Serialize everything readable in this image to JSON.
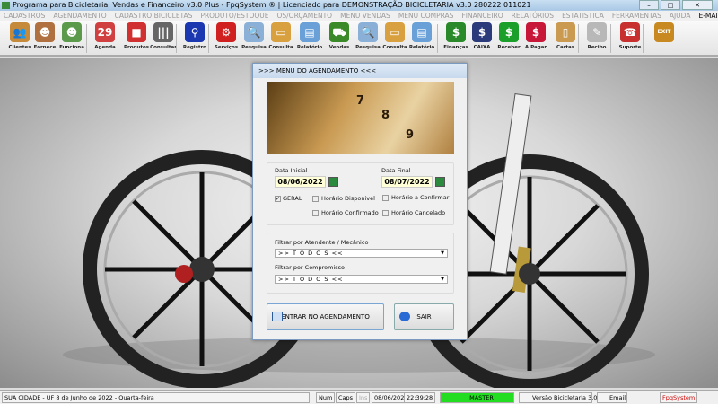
{
  "window": {
    "title": "Programa para Bicicletaria, Vendas e Financeiro v3.0 Plus - FpqSystem ® | Licenciado para  DEMONSTRAÇÃO BICICLETARIA v3.0 280222 011021",
    "minimize": "–",
    "maximize": "□",
    "close": "✕"
  },
  "menu": [
    "CADASTROS",
    "AGENDAMENTO",
    "CADASTRO BICICLETAS",
    "PRODUTO/ESTOQUE",
    "OS/ORÇAMENTO",
    "MENU VENDAS",
    "MENU COMPRAS",
    "FINANCEIRO",
    "RELATÓRIOS",
    "ESTATISTICA",
    "FERRAMENTAS",
    "AJUDA",
    "E-MAIL"
  ],
  "toolbar": [
    {
      "label": "Clientes",
      "color": "#c58a3a",
      "glyph": "👥"
    },
    {
      "label": "Fornece",
      "color": "#b07040",
      "glyph": "☻"
    },
    {
      "label": "Funciona",
      "color": "#5a9a4a",
      "glyph": "☻"
    },
    {
      "label": "Agenda",
      "color": "#d04040",
      "glyph": "29"
    },
    {
      "label": "Produtos",
      "color": "#d03030",
      "glyph": "■"
    },
    {
      "label": "Consultar",
      "color": "#666",
      "glyph": "|||"
    },
    {
      "label": "Registro",
      "color": "#1c38b0",
      "glyph": "⚲"
    },
    {
      "label": "Serviços",
      "color": "#d02020",
      "glyph": "⚙"
    },
    {
      "label": "Pesquisa",
      "color": "#8ab0d8",
      "glyph": "🔍"
    },
    {
      "label": "Consulta",
      "color": "#d9a040",
      "glyph": "▭"
    },
    {
      "label": "Relatório",
      "color": "#6aa0d8",
      "glyph": "▤"
    },
    {
      "label": "Vendas",
      "color": "#3a8a2a",
      "glyph": "⛟"
    },
    {
      "label": "Pesquisa",
      "color": "#8ab0d8",
      "glyph": "🔍"
    },
    {
      "label": "Consulta",
      "color": "#d9a040",
      "glyph": "▭"
    },
    {
      "label": "Relatório",
      "color": "#6aa0d8",
      "glyph": "▤"
    },
    {
      "label": "Finanças",
      "color": "#2a8a2a",
      "glyph": "$"
    },
    {
      "label": "CAIXA",
      "color": "#2a3a7a",
      "glyph": "$"
    },
    {
      "label": "Receber",
      "color": "#1aa02a",
      "glyph": "$"
    },
    {
      "label": "A Pagar",
      "color": "#c8183a",
      "glyph": "$"
    },
    {
      "label": "Cartas",
      "color": "#c99a50",
      "glyph": "▯"
    },
    {
      "label": "Recibo",
      "color": "#b8b8b8",
      "glyph": "✎"
    },
    {
      "label": "Suporte",
      "color": "#c83030",
      "glyph": "☎"
    },
    {
      "label": "",
      "color": "#c88a20",
      "glyph": "EXIT"
    }
  ],
  "dialog": {
    "title": ">>>  MENU DO AGENDAMENTO  <<<",
    "photo_numbers": [
      "7",
      "8",
      "9"
    ],
    "data_inicial_label": "Data Inicial",
    "data_inicial": "08/06/2022",
    "data_final_label": "Data Final",
    "data_final": "08/07/2022",
    "checks": [
      {
        "label": "GERAL",
        "checked": true
      },
      {
        "label": "Horário  Disponivel",
        "checked": false
      },
      {
        "label": "Horário a Confirmar",
        "checked": false
      },
      {
        "label": "Horário Confirmado",
        "checked": false
      },
      {
        "label": "Horário Cancelado",
        "checked": false
      }
    ],
    "filtro_atendente_label": "Filtrar por Atendente / Mecânico",
    "filtro_atendente": ">> T O D O S <<",
    "filtro_compromisso_label": "Filtrar por Compromisso",
    "filtro_compromisso": ">> T O D O S <<",
    "enter_button": "ENTRAR NO AGENDAMENTO",
    "exit_button": "SAIR",
    "check_mark": "✓",
    "arrow": "▼"
  },
  "status": {
    "location": "SUA CIDADE - UF  8 de Junho de 2022 - Quarta-feira",
    "num": "Num",
    "caps": "Caps",
    "ins": "Ins",
    "date": "08/06/2022",
    "time": "22:39:28",
    "user": "MASTER",
    "version": "Versão Bicicletaria 3.0",
    "email": "Email",
    "brand": "FpqSystem",
    "user_color": "#22dd22"
  }
}
